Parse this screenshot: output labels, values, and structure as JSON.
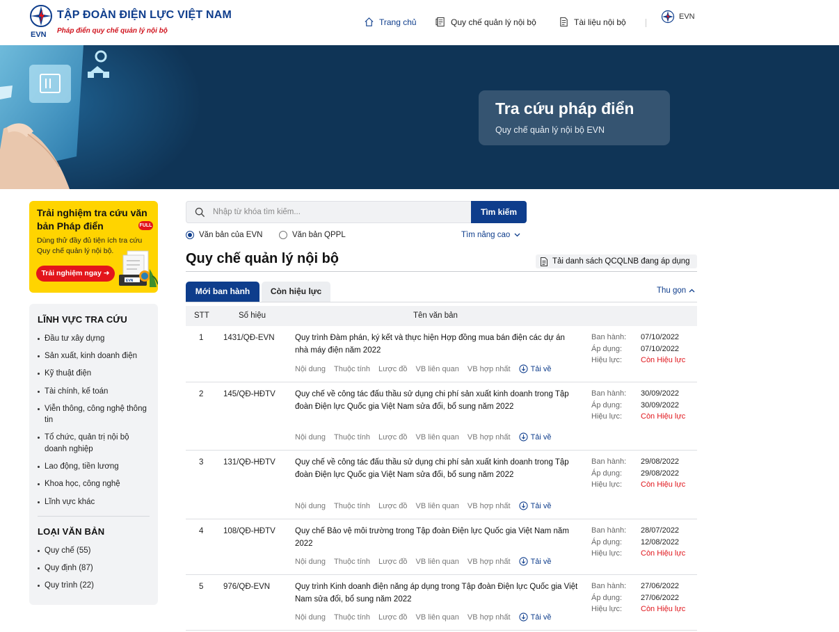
{
  "header": {
    "logo_text": "EVN",
    "brand_title": "TẬP ĐOÀN ĐIỆN LỰC VIỆT NAM",
    "brand_sub": "Pháp điển quy chế quản lý nội bộ",
    "nav": [
      {
        "label": "Trang chủ",
        "icon": "home-icon"
      },
      {
        "label": "Quy chế quản lý nội bộ",
        "icon": "document-list-icon"
      },
      {
        "label": "Tài liệu nội bộ",
        "icon": "document-icon"
      }
    ],
    "lang_label": "EVN"
  },
  "banner": {
    "title": "Tra cứu pháp điển",
    "subtitle": "Quy chế quản lý nội bộ EVN"
  },
  "promo": {
    "title": "Trải nghiệm tra cứu văn bản Pháp điển",
    "badge": "FULL",
    "text": "Dùng thử đầy đủ tiện ích tra cứu Quy chế quản lý nội bộ.",
    "button": "Trải nghiệm ngay ➜",
    "art_label": "EVN"
  },
  "sidebar": {
    "section1_title": "LĨNH VỰC TRA CỨU",
    "fields": [
      "Đầu tư xây dựng",
      "Sản xuất, kinh doanh điện",
      "Kỹ thuật điện",
      "Tài chính, kế toán",
      "Viễn thông, công nghệ thông tin",
      "Tổ chức, quản trị nội bộ doanh nghiệp",
      "Lao động, tiền lương",
      "Khoa học, công nghệ",
      "Lĩnh vực khác"
    ],
    "section2_title": "LOẠI VĂN BẢN",
    "types": [
      "Quy chế (55)",
      "Quy định (87)",
      "Quy trình (22)"
    ]
  },
  "search": {
    "placeholder": "Nhập từ khóa tìm kiếm...",
    "button": "Tìm kiếm",
    "radio_evn": "Văn bản của EVN",
    "radio_qppl": "Văn bản QPPL",
    "advanced": "Tìm nâng cao"
  },
  "content": {
    "title": "Quy chế quản lý nội bộ",
    "download_list": "Tải danh sách QCQLNB đang áp dụng",
    "tab_new": "Mới ban hành",
    "tab_valid": "Còn hiệu lực",
    "collapse": "Thu gọn",
    "columns": {
      "stt": "STT",
      "number": "Số hiệu",
      "name": "Tên văn bản"
    },
    "labels": {
      "issued": "Ban hành:",
      "applied": "Áp dụng:",
      "effect": "Hiệu lực:"
    },
    "actions": [
      "Nội dung",
      "Thuộc tính",
      "Lược đồ",
      "VB liên quan",
      "VB hợp nhất",
      "Tải về"
    ],
    "rows": [
      {
        "stt": "1",
        "number": "1431/QĐ-EVN",
        "title": "Quy trình Đàm phán, ký kết và thực hiện Hợp đồng mua bán điện các dự án nhà máy điện năm 2022",
        "issued": "07/10/2022",
        "applied": "07/10/2022",
        "effect": "Còn Hiệu lực"
      },
      {
        "stt": "2",
        "number": "145/QĐ-HĐTV",
        "title": "Quy chế về công tác đấu thầu sử dụng chi phí sản xuất kinh doanh trong Tập đoàn Điện lực Quốc gia Việt Nam sửa đổi, bổ sung năm 2022",
        "issued": "30/09/2022",
        "applied": "30/09/2022",
        "effect": "Còn Hiệu lực"
      },
      {
        "stt": "3",
        "number": "131/QĐ-HĐTV",
        "title": "Quy chế về công tác đấu thầu sử dụng chi phí sản xuất kinh doanh trong Tập đoàn Điện lực Quốc gia Việt Nam sửa đổi, bổ sung năm 2022",
        "issued": "29/08/2022",
        "applied": "29/08/2022",
        "effect": "Còn Hiệu lực"
      },
      {
        "stt": "4",
        "number": "108/QĐ-HĐTV",
        "title": "Quy chế Bảo vệ môi trường trong Tập đoàn Điện lực Quốc gia Việt Nam năm 2022",
        "issued": "28/07/2022",
        "applied": "12/08/2022",
        "effect": "Còn Hiệu lực"
      },
      {
        "stt": "5",
        "number": "976/QĐ-EVN",
        "title": "Quy trình Kinh doanh điện năng áp dụng trong Tập đoàn Điện lực Quốc gia Việt Nam sửa đổi, bổ sung năm 2022",
        "issued": "27/06/2022",
        "applied": "27/06/2022",
        "effect": "Còn Hiệu lực"
      }
    ]
  },
  "colors": {
    "primary": "#0e3d8c",
    "accent_red": "#e3151b",
    "banner_bg": "#0f3456",
    "promo_yellow": "#ffd400"
  }
}
